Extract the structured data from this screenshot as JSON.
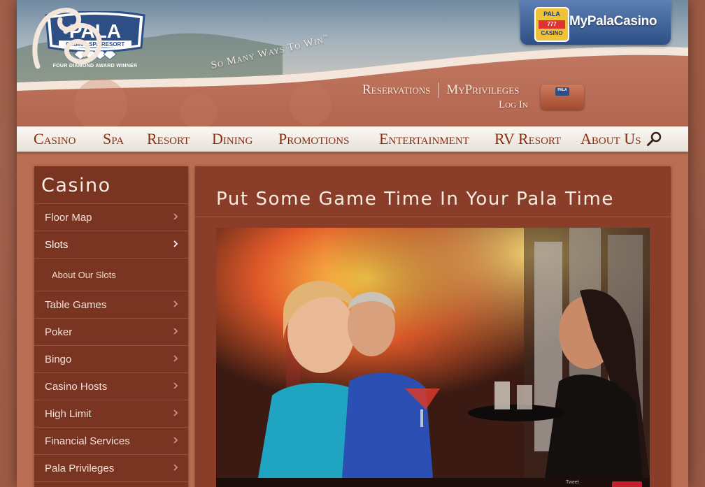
{
  "brand": {
    "logo_name": "PALA",
    "logo_sub": "CASINO SPA RESORT",
    "award": "FOUR DIAMOND AWARD WINNER",
    "tagline": "So Many Ways To Win",
    "tagline_mark": "™"
  },
  "mypala": {
    "label": "MyPalaCasino",
    "logo_top": "PALA",
    "logo_mid": "777",
    "logo_bottom": "CASINO"
  },
  "top_links": {
    "reservations": "Reservations",
    "myprivileges": "MyPrivileges",
    "login": "Log In",
    "card_label": "PALA"
  },
  "nav": {
    "items": [
      "Casino",
      "Spa",
      "Resort",
      "Dining",
      "Promotions",
      "Entertainment",
      "RV Resort",
      "About Us"
    ]
  },
  "sidebar": {
    "title": "Casino",
    "items": [
      {
        "label": "Floor Map"
      },
      {
        "label": "Slots",
        "active": true
      },
      {
        "label": "About Our Slots",
        "sub": true
      },
      {
        "label": "Table Games"
      },
      {
        "label": "Poker"
      },
      {
        "label": "Bingo"
      },
      {
        "label": "Casino Hosts"
      },
      {
        "label": "High Limit"
      },
      {
        "label": "Financial Services"
      },
      {
        "label": "Pala Privileges"
      }
    ]
  },
  "main": {
    "title": "Put Some Game Time In Your Pala Time",
    "tweet_label": "Tweet"
  },
  "colors": {
    "brand_blue": "#2d4f86",
    "nav_text": "#8a2e12",
    "sidebar_bg": "#7a3422",
    "content_bg": "#8a3d28"
  }
}
